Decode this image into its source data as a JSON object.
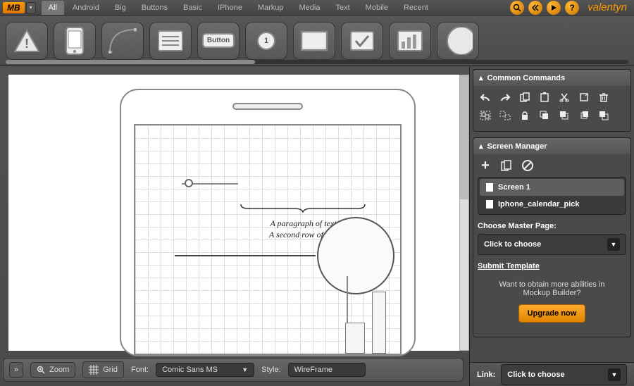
{
  "logo": "MB",
  "tabs": [
    "All",
    "Android",
    "Big",
    "Buttons",
    "Basic",
    "IPhone",
    "Markup",
    "Media",
    "Text",
    "Mobile",
    "Recent"
  ],
  "active_tab": "All",
  "username": "valentyn",
  "top_icons": [
    "search",
    "share",
    "play",
    "help"
  ],
  "stencils": [
    "alert",
    "phone",
    "curve",
    "list",
    "button",
    "badge",
    "rect",
    "checkbox",
    "chart",
    "circle"
  ],
  "stencil_button_label": "Button",
  "stencil_badge_num": "1",
  "canvas": {
    "paragraph_l1": "A paragraph of text.",
    "paragraph_l2": "A second row of text."
  },
  "statusbar": {
    "zoom": "Zoom",
    "grid": "Grid",
    "font_label": "Font:",
    "font_value": "Comic Sans MS",
    "style_label": "Style:",
    "style_value": "WireFrame"
  },
  "panels": {
    "commands_title": "Common Commands",
    "sm_title": "Screen Manager",
    "screens": [
      "Screen 1",
      "Iphone_calendar_pick"
    ],
    "choose_master_label": "Choose Master Page:",
    "choose_master_value": "Click to choose",
    "submit": "Submit Template",
    "upgrade_text_l1": "Want to obtain more abilities in",
    "upgrade_text_l2": "Mockup Builder?",
    "upgrade_btn": "Upgrade now"
  },
  "bottom": {
    "link_label": "Link:",
    "link_value": "Click to choose"
  }
}
